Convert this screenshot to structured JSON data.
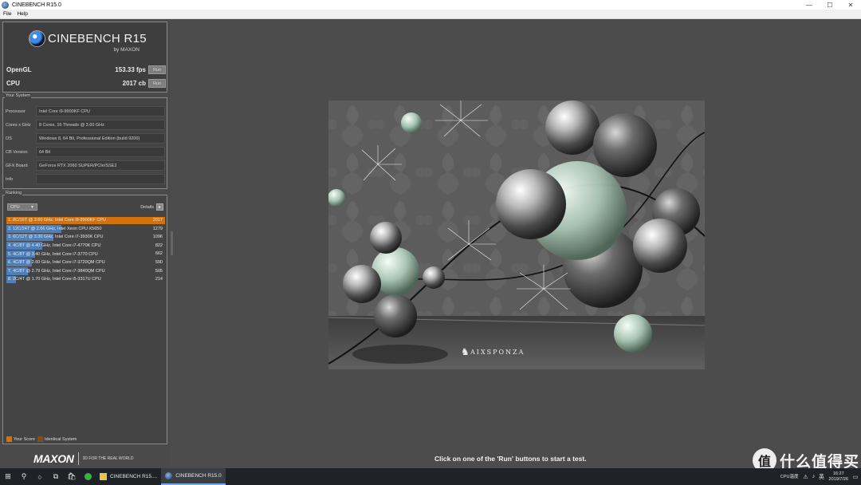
{
  "window": {
    "title": "CINEBENCH R15.0",
    "controls": [
      "—",
      "☐",
      "✕"
    ]
  },
  "menu": [
    "File",
    "Help"
  ],
  "logo": {
    "brand": "CINEBENCH R15",
    "by": "by MAXON"
  },
  "scores": {
    "opengl": {
      "label": "OpenGL",
      "value": "153.33 fps",
      "run": "Run"
    },
    "cpu": {
      "label": "CPU",
      "value": "2017 cb",
      "run": "Run"
    }
  },
  "system": {
    "title": "Your System",
    "rows": [
      {
        "key": "Processor",
        "value": "Intel Core i9-9900KF CPU"
      },
      {
        "key": "Cores x GHz",
        "value": "8 Cores, 16 Threads @ 3.60 GHz"
      },
      {
        "key": "OS",
        "value": "Windows 8, 64 Bit, Professional Edition (build 9200)"
      },
      {
        "key": "CB Version",
        "value": "64 Bit"
      },
      {
        "key": "GFX Board",
        "value": "GeForce RTX 2060 SUPER/PCIe/SSE2"
      },
      {
        "key": "Info",
        "value": ""
      }
    ]
  },
  "ranking": {
    "title": "Ranking",
    "select": "CPU",
    "details_label": "Details",
    "details_btn": "▸",
    "max": 2017,
    "items": [
      {
        "label": "1. 8C/16T @ 3.60 GHz, Intel Core i9-9900KF CPU",
        "score": 2017,
        "mine": true
      },
      {
        "label": "2. 12C/24T @ 2.66 GHz, Intel Xeon CPU X5650",
        "score": 1279,
        "mine": false
      },
      {
        "label": "3. 6C/12T @ 3.30 GHz,  Intel Core i7-3930K CPU",
        "score": 1096,
        "mine": false
      },
      {
        "label": "4. 4C/8T @ 4.40 GHz, Intel Core i7-4770K CPU",
        "score": 822,
        "mine": false
      },
      {
        "label": "5. 4C/8T @ 3.40 GHz,  Intel Core i7-3770 CPU",
        "score": 662,
        "mine": false
      },
      {
        "label": "6. 4C/8T @ 2.60 GHz, Intel Core i7-3720QM CPU",
        "score": 590,
        "mine": false
      },
      {
        "label": "7. 4C/8T @ 2.79 GHz,  Intel Core i7-3840QM CPU",
        "score": 505,
        "mine": false
      },
      {
        "label": "8. 2C/4T @ 1.70 GHz,  Intel Core i5-3317U CPU",
        "score": 214,
        "mine": false
      }
    ],
    "legend": {
      "your_score": "Your Score",
      "identical": "Identical System"
    }
  },
  "footer": {
    "maxon": "MAXON",
    "tagline": "3D FOR THE REAL WORLD"
  },
  "render": {
    "credit": "AIXSPONZA"
  },
  "status_text": "Click on one of the 'Run' buttons to start a test.",
  "taskbar": {
    "tasks": [
      {
        "label": "CINEBENCH R15....",
        "active": false
      },
      {
        "label": "CINEBENCH R15.0",
        "active": true
      }
    ],
    "tray": {
      "cpu_temp": "CPU温度",
      "time": "16:27",
      "date": "2019/7/26"
    }
  },
  "watermark": {
    "mark": "值",
    "text": "什么值得买"
  },
  "colors": {
    "my_score": "#d2720e",
    "other_score": "#4f7fb6",
    "identical": "#8a4a10"
  }
}
